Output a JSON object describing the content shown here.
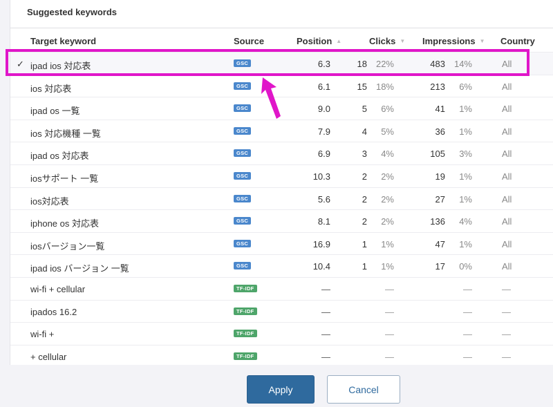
{
  "panel": {
    "title": "Suggested keywords"
  },
  "table": {
    "headers": {
      "keyword": "Target keyword",
      "source": "Source",
      "position": "Position",
      "clicks": "Clicks",
      "impressions": "Impressions",
      "country": "Country"
    },
    "sort_icons": {
      "position": "sort-asc",
      "clicks": "sort-desc",
      "impressions": "sort-desc"
    },
    "rows": [
      {
        "selected": true,
        "keyword": "ipad ios 対応表",
        "source": "GSC",
        "position": "6.3",
        "clicks": "18",
        "clicks_pct": "22%",
        "impressions": "483",
        "impressions_pct": "14%",
        "country": "All"
      },
      {
        "selected": false,
        "keyword": "ios 対応表",
        "source": "GSC",
        "position": "6.1",
        "clicks": "15",
        "clicks_pct": "18%",
        "impressions": "213",
        "impressions_pct": "6%",
        "country": "All"
      },
      {
        "selected": false,
        "keyword": "ipad os 一覧",
        "source": "GSC",
        "position": "9.0",
        "clicks": "5",
        "clicks_pct": "6%",
        "impressions": "41",
        "impressions_pct": "1%",
        "country": "All"
      },
      {
        "selected": false,
        "keyword": "ios 対応機種 一覧",
        "source": "GSC",
        "position": "7.9",
        "clicks": "4",
        "clicks_pct": "5%",
        "impressions": "36",
        "impressions_pct": "1%",
        "country": "All"
      },
      {
        "selected": false,
        "keyword": "ipad os 対応表",
        "source": "GSC",
        "position": "6.9",
        "clicks": "3",
        "clicks_pct": "4%",
        "impressions": "105",
        "impressions_pct": "3%",
        "country": "All"
      },
      {
        "selected": false,
        "keyword": "iosサポート 一覧",
        "source": "GSC",
        "position": "10.3",
        "clicks": "2",
        "clicks_pct": "2%",
        "impressions": "19",
        "impressions_pct": "1%",
        "country": "All"
      },
      {
        "selected": false,
        "keyword": "ios対応表",
        "source": "GSC",
        "position": "5.6",
        "clicks": "2",
        "clicks_pct": "2%",
        "impressions": "27",
        "impressions_pct": "1%",
        "country": "All"
      },
      {
        "selected": false,
        "keyword": "iphone os 対応表",
        "source": "GSC",
        "position": "8.1",
        "clicks": "2",
        "clicks_pct": "2%",
        "impressions": "136",
        "impressions_pct": "4%",
        "country": "All"
      },
      {
        "selected": false,
        "keyword": "iosバージョン一覧",
        "source": "GSC",
        "position": "16.9",
        "clicks": "1",
        "clicks_pct": "1%",
        "impressions": "47",
        "impressions_pct": "1%",
        "country": "All"
      },
      {
        "selected": false,
        "keyword": "ipad ios バージョン 一覧",
        "source": "GSC",
        "position": "10.4",
        "clicks": "1",
        "clicks_pct": "1%",
        "impressions": "17",
        "impressions_pct": "0%",
        "country": "All"
      },
      {
        "selected": false,
        "keyword": "wi-fi + cellular",
        "source": "TF-IDF",
        "position": "—",
        "clicks": "",
        "clicks_pct": "—",
        "impressions": "",
        "impressions_pct": "—",
        "country": "—"
      },
      {
        "selected": false,
        "keyword": "ipados 16.2",
        "source": "TF-IDF",
        "position": "—",
        "clicks": "",
        "clicks_pct": "—",
        "impressions": "",
        "impressions_pct": "—",
        "country": "—"
      },
      {
        "selected": false,
        "keyword": "wi-fi +",
        "source": "TF-IDF",
        "position": "—",
        "clicks": "",
        "clicks_pct": "—",
        "impressions": "",
        "impressions_pct": "—",
        "country": "—"
      },
      {
        "selected": false,
        "keyword": "+ cellular",
        "source": "TF-IDF",
        "position": "—",
        "clicks": "",
        "clicks_pct": "—",
        "impressions": "",
        "impressions_pct": "—",
        "country": "—"
      }
    ]
  },
  "footer": {
    "apply_label": "Apply",
    "cancel_label": "Cancel"
  },
  "colors": {
    "gsc_badge": "#4a87cc",
    "tfidf_badge": "#4ea56a",
    "primary": "#2f6a9e",
    "annotation": "#e016c9"
  },
  "icons": {
    "selected_row": "checkmark-icon",
    "annotation": "arrow-up-icon"
  }
}
